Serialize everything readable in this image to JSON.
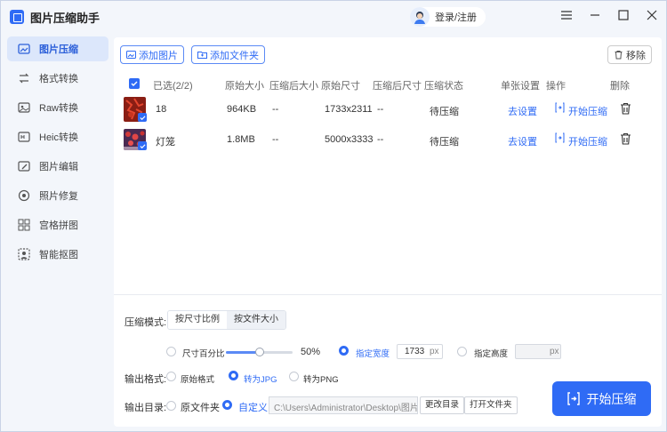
{
  "app": {
    "title": "图片压缩助手",
    "login_label": "登录/注册"
  },
  "sidebar": {
    "items": [
      {
        "label": "图片压缩",
        "icon": "compress-icon"
      },
      {
        "label": "格式转换",
        "icon": "convert-icon"
      },
      {
        "label": "Raw转换",
        "icon": "raw-icon"
      },
      {
        "label": "Heic转换",
        "icon": "heic-icon"
      },
      {
        "label": "图片编辑",
        "icon": "edit-icon"
      },
      {
        "label": "照片修复",
        "icon": "repair-icon"
      },
      {
        "label": "宫格拼图",
        "icon": "grid-icon"
      },
      {
        "label": "智能抠图",
        "icon": "cutout-icon"
      }
    ]
  },
  "toolbar": {
    "add_image": "添加图片",
    "add_folder": "添加文件夹",
    "remove": "移除"
  },
  "table": {
    "headers": {
      "selected": "已选(2/2)",
      "orig_size": "原始大小",
      "comp_size": "压缩后大小",
      "orig_dim": "原始尺寸",
      "comp_dim": "压缩后尺寸",
      "status": "压缩状态",
      "single_setting": "单张设置",
      "action": "操作",
      "delete": "删除"
    },
    "rows": [
      {
        "name": "18",
        "orig_size": "964KB",
        "comp_size": "--",
        "orig_dim": "1733x2311",
        "comp_dim": "--",
        "status": "待压缩",
        "setting": "去设置",
        "action": "开始压缩"
      },
      {
        "name": "灯笼",
        "orig_size": "1.8MB",
        "comp_size": "--",
        "orig_dim": "5000x3333",
        "comp_dim": "--",
        "status": "待压缩",
        "setting": "去设置",
        "action": "开始压缩"
      }
    ]
  },
  "settings": {
    "mode_label": "压缩模式:",
    "mode_tabs": [
      "按尺寸比例",
      "按文件大小"
    ],
    "size_percent_label": "尺寸百分比",
    "size_percent_value": "50%",
    "size_percent": 0.5,
    "fixed_width_label": "指定宽度",
    "fixed_width_value": "1733",
    "fixed_height_label": "指定高度",
    "fixed_height_value": "",
    "unit": "px",
    "format_label": "输出格式:",
    "formats": [
      "原始格式",
      "转为JPG",
      "转为PNG"
    ],
    "output_label": "输出目录:",
    "output_options": [
      "原文件夹",
      "自定义"
    ],
    "output_path": "C:\\Users\\Administrator\\Desktop\\图片",
    "change_dir": "更改目录",
    "open_folder": "打开文件夹",
    "start": "开始压缩"
  }
}
